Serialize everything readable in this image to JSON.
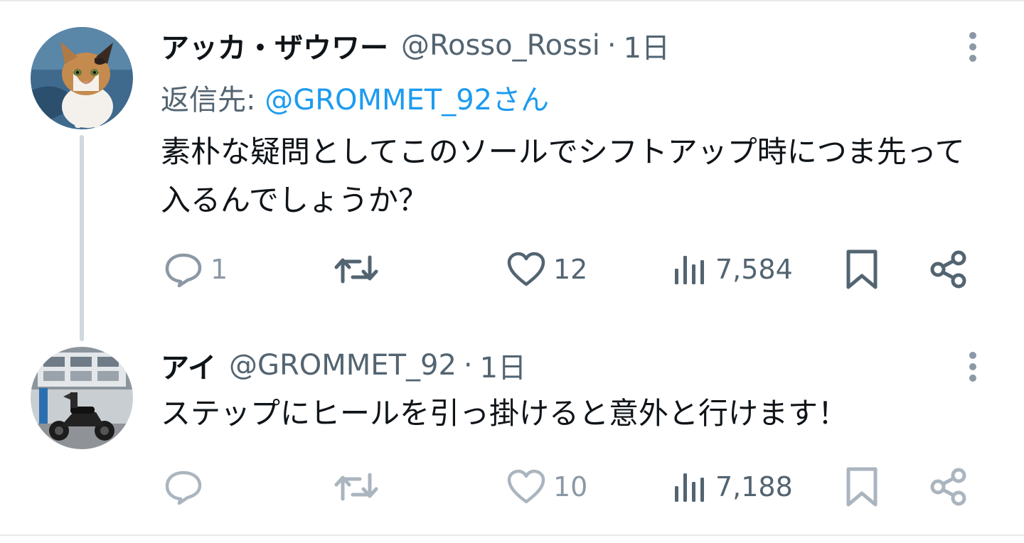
{
  "tweets": [
    {
      "display_name": "アッカ・ザウワー",
      "handle": "@Rosso_Rossi",
      "separator": "·",
      "time": "1日",
      "reply_to_label": "返信先: ",
      "reply_to_mention": "@GROMMET_92さん",
      "text": "素朴な疑問としてこのソールでシフトアップ時につま先って入るんでしょうか？",
      "avatar": "cat-avatar",
      "actions": {
        "reply_count": "1",
        "retweet_count": "",
        "like_count": "12",
        "views_count": "7,584"
      }
    },
    {
      "display_name": "アイ",
      "handle": "@GROMMET_92",
      "separator": "·",
      "time": "1日",
      "text": "ステップにヒールを引っ掛けると意外と行けます！",
      "avatar": "motorcycle-avatar",
      "actions": {
        "reply_count": "",
        "retweet_count": "",
        "like_count": "10",
        "views_count": "7,188"
      }
    }
  ],
  "colors": {
    "text": "#0f1419",
    "secondary": "#536471",
    "muted": "#8b98a5",
    "link": "#1d9bf0",
    "border": "#e7e9ea",
    "thread_line": "#cfd9de"
  },
  "icons": [
    "more-icon",
    "reply-icon",
    "retweet-icon",
    "like-icon",
    "views-icon",
    "bookmark-icon",
    "share-icon"
  ]
}
